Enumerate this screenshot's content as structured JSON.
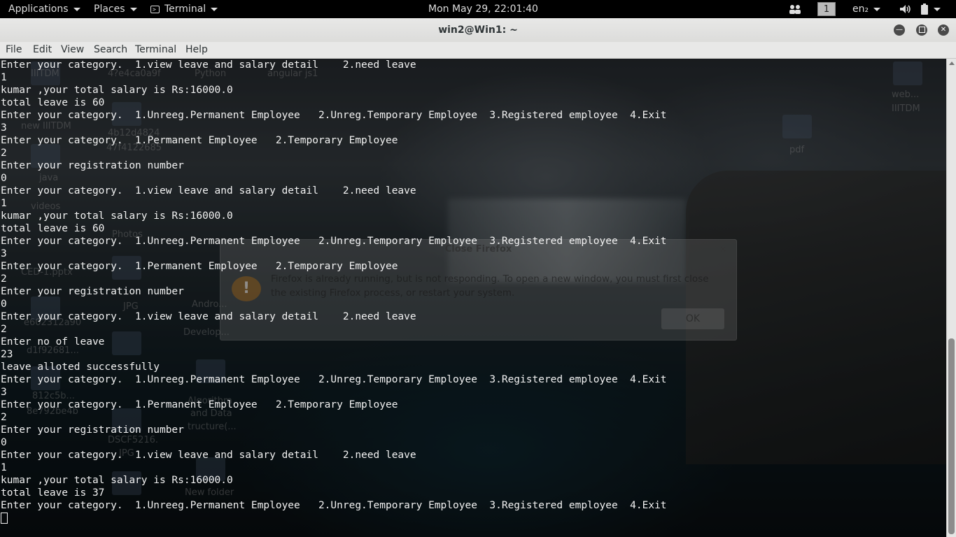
{
  "topbar": {
    "applications": "Applications",
    "places": "Places",
    "terminal": "Terminal",
    "clock": "Mon May 29, 22:01:40",
    "workspace": "1",
    "keyboard_layout": "en₂"
  },
  "window": {
    "title": "win2@Win1: ~"
  },
  "menubar": {
    "file": "File",
    "edit": "Edit",
    "view": "View",
    "search": "Search",
    "terminal": "Terminal",
    "help": "Help"
  },
  "terminal_lines": [
    "Enter your category.  1.view leave and salary detail    2.need leave",
    "1",
    "kumar ,your total salary is Rs:16000.0",
    "total leave is 60",
    "Enter your category.  1.Unreeg.Permanent Employee   2.Unreg.Temporary Employee  3.Registered employee  4.Exit",
    "3",
    "Enter your category.  1.Permanent Employee   2.Temporary Employee",
    "2",
    "Enter your registration number",
    "0",
    "Enter your category.  1.view leave and salary detail    2.need leave",
    "1",
    "kumar ,your total salary is Rs:16000.0",
    "total leave is 60",
    "Enter your category.  1.Unreeg.Permanent Employee   2.Unreg.Temporary Employee  3.Registered employee  4.Exit",
    "3",
    "Enter your category.  1.Permanent Employee   2.Temporary Employee",
    "2",
    "Enter your registration number",
    "0",
    "Enter your category.  1.view leave and salary detail    2.need leave",
    "2",
    "Enter no of leave",
    "23",
    "leave alloted successfully",
    "Enter your category.  1.Unreeg.Permanent Employee   2.Unreg.Temporary Employee  3.Registered employee  4.Exit",
    "3",
    "Enter your category.  1.Permanent Employee   2.Temporary Employee",
    "2",
    "Enter your registration number",
    "0",
    "Enter your category.  1.view leave and salary detail    2.need leave",
    "1",
    "kumar ,your total salary is Rs:16000.0",
    "total leave is 37",
    "Enter your category.  1.Unreeg.Permanent Employee   2.Unreg.Temporary Employee  3.Registered employee  4.Exit"
  ],
  "background_dialog": {
    "title": "Close Firefox",
    "message": "Firefox is already running, but is not responding. To open a new window, you must first close the existing Firefox process, or restart your system.",
    "ok_label": "OK",
    "close_glyph": "×",
    "icon_glyph": "!"
  },
  "desktop_labels": [
    "IIITDM",
    "4?e4ca0a9f",
    "Python",
    "angular js1",
    "web...",
    "IIITDM",
    "new IIITDM",
    "4b12d4824",
    "47f4122685",
    "pdf",
    "java",
    "videos",
    "Photos",
    "CED-1.pptx",
    "JPG",
    "Andro...",
    "e602312a90",
    "Develop...",
    "d1f92681...",
    "812c5b...",
    "8e792be4b",
    "Algorithm",
    "and Data",
    "tructure(...",
    "DSCF5216.",
    "JPG",
    "New folder"
  ],
  "icons": {
    "terminal": "terminal-icon",
    "people": "people-icon",
    "volume": "volume-icon",
    "battery": "battery-icon",
    "minimize": "minimize-icon",
    "maximize": "maximize-icon",
    "close": "close-icon"
  }
}
